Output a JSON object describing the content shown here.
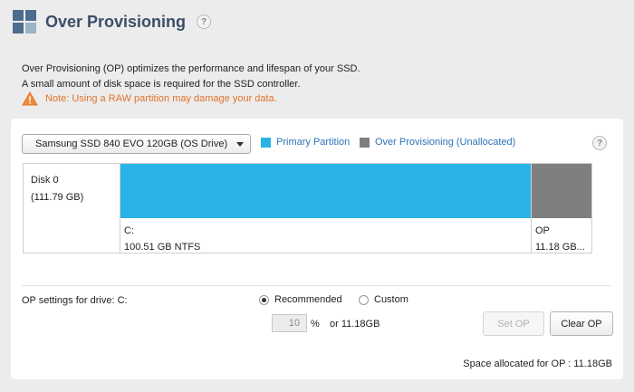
{
  "header": {
    "title": "Over Provisioning",
    "help_icon": "?"
  },
  "description": {
    "line1": "Over Provisioning (OP) optimizes the performance and lifespan of your SSD.",
    "line2": "A small amount of disk space is required for the SSD controller.",
    "warning": "Note: Using a RAW partition may damage your data."
  },
  "drive_select": {
    "value": "Samsung SSD 840 EVO 120GB (OS Drive)"
  },
  "legend": [
    {
      "label": "Primary Partition",
      "color": "#2ab4e6"
    },
    {
      "label": "Over Provisioning (Unallocated)",
      "color": "#7f7f7f"
    }
  ],
  "panel_help_icon": "?",
  "disk": {
    "name": "Disk 0",
    "size": "(111.79 GB)",
    "partitions": [
      {
        "label": "C:",
        "detail": "100.51 GB NTFS",
        "color": "#2ab4e6"
      },
      {
        "label": "OP",
        "detail": "11.18 GB...",
        "color": "#7f7f7f"
      }
    ]
  },
  "op_settings": {
    "label": "OP settings for drive: C:",
    "options": [
      {
        "label": "Recommended",
        "selected": true
      },
      {
        "label": "Custom",
        "selected": false
      }
    ],
    "percent_value": "10",
    "percent_sign": "%",
    "or_text": "or  11.18GB",
    "set_button": "Set OP",
    "clear_button": "Clear OP",
    "space_allocated": "Space allocated for OP : 11.18GB"
  },
  "colors": {
    "title": "#3a4f66",
    "warning": "#e0742b",
    "legend_text": "#2d72b8"
  }
}
